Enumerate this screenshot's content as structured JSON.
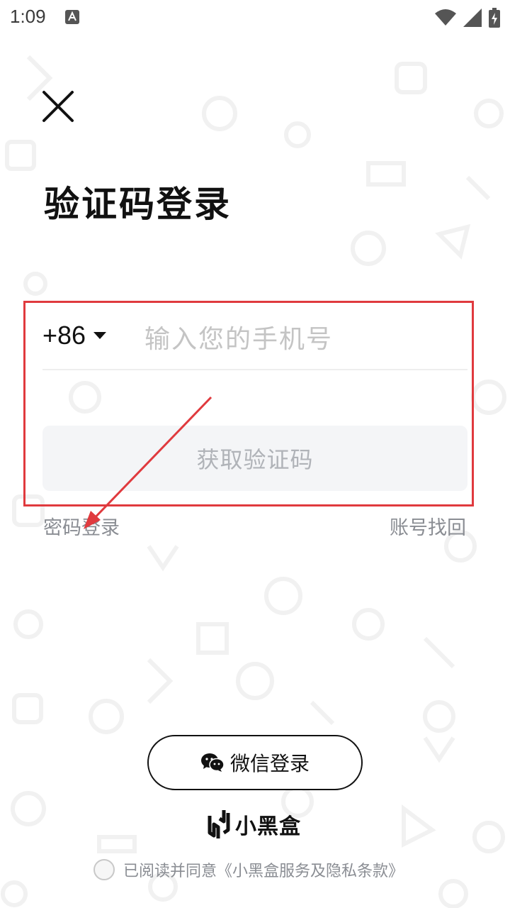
{
  "status_bar": {
    "time": "1:09",
    "icons": [
      "notification-a-icon",
      "wifi-icon",
      "signal-icon",
      "battery-charging-icon"
    ]
  },
  "header": {
    "close_icon": "close-icon",
    "title": "验证码登录"
  },
  "form": {
    "country_code": "+86",
    "phone_placeholder": "输入您的手机号",
    "phone_value": "",
    "get_code_label": "获取验证码"
  },
  "links": {
    "password_login": "密码登录",
    "account_recovery": "账号找回"
  },
  "wechat": {
    "label": "微信登录",
    "icon": "wechat-icon"
  },
  "brand": {
    "name": "小黑盒",
    "logo": "xiaoheihe-logo-icon"
  },
  "agreement": {
    "prefix": "已阅读并同意",
    "link": "《小黑盒服务及隐私条款》",
    "checked": false
  },
  "colors": {
    "annotation": "#e03a3e",
    "button_bg": "#f4f5f7",
    "muted_text": "#8a8d93",
    "placeholder": "#c4c4c4"
  }
}
